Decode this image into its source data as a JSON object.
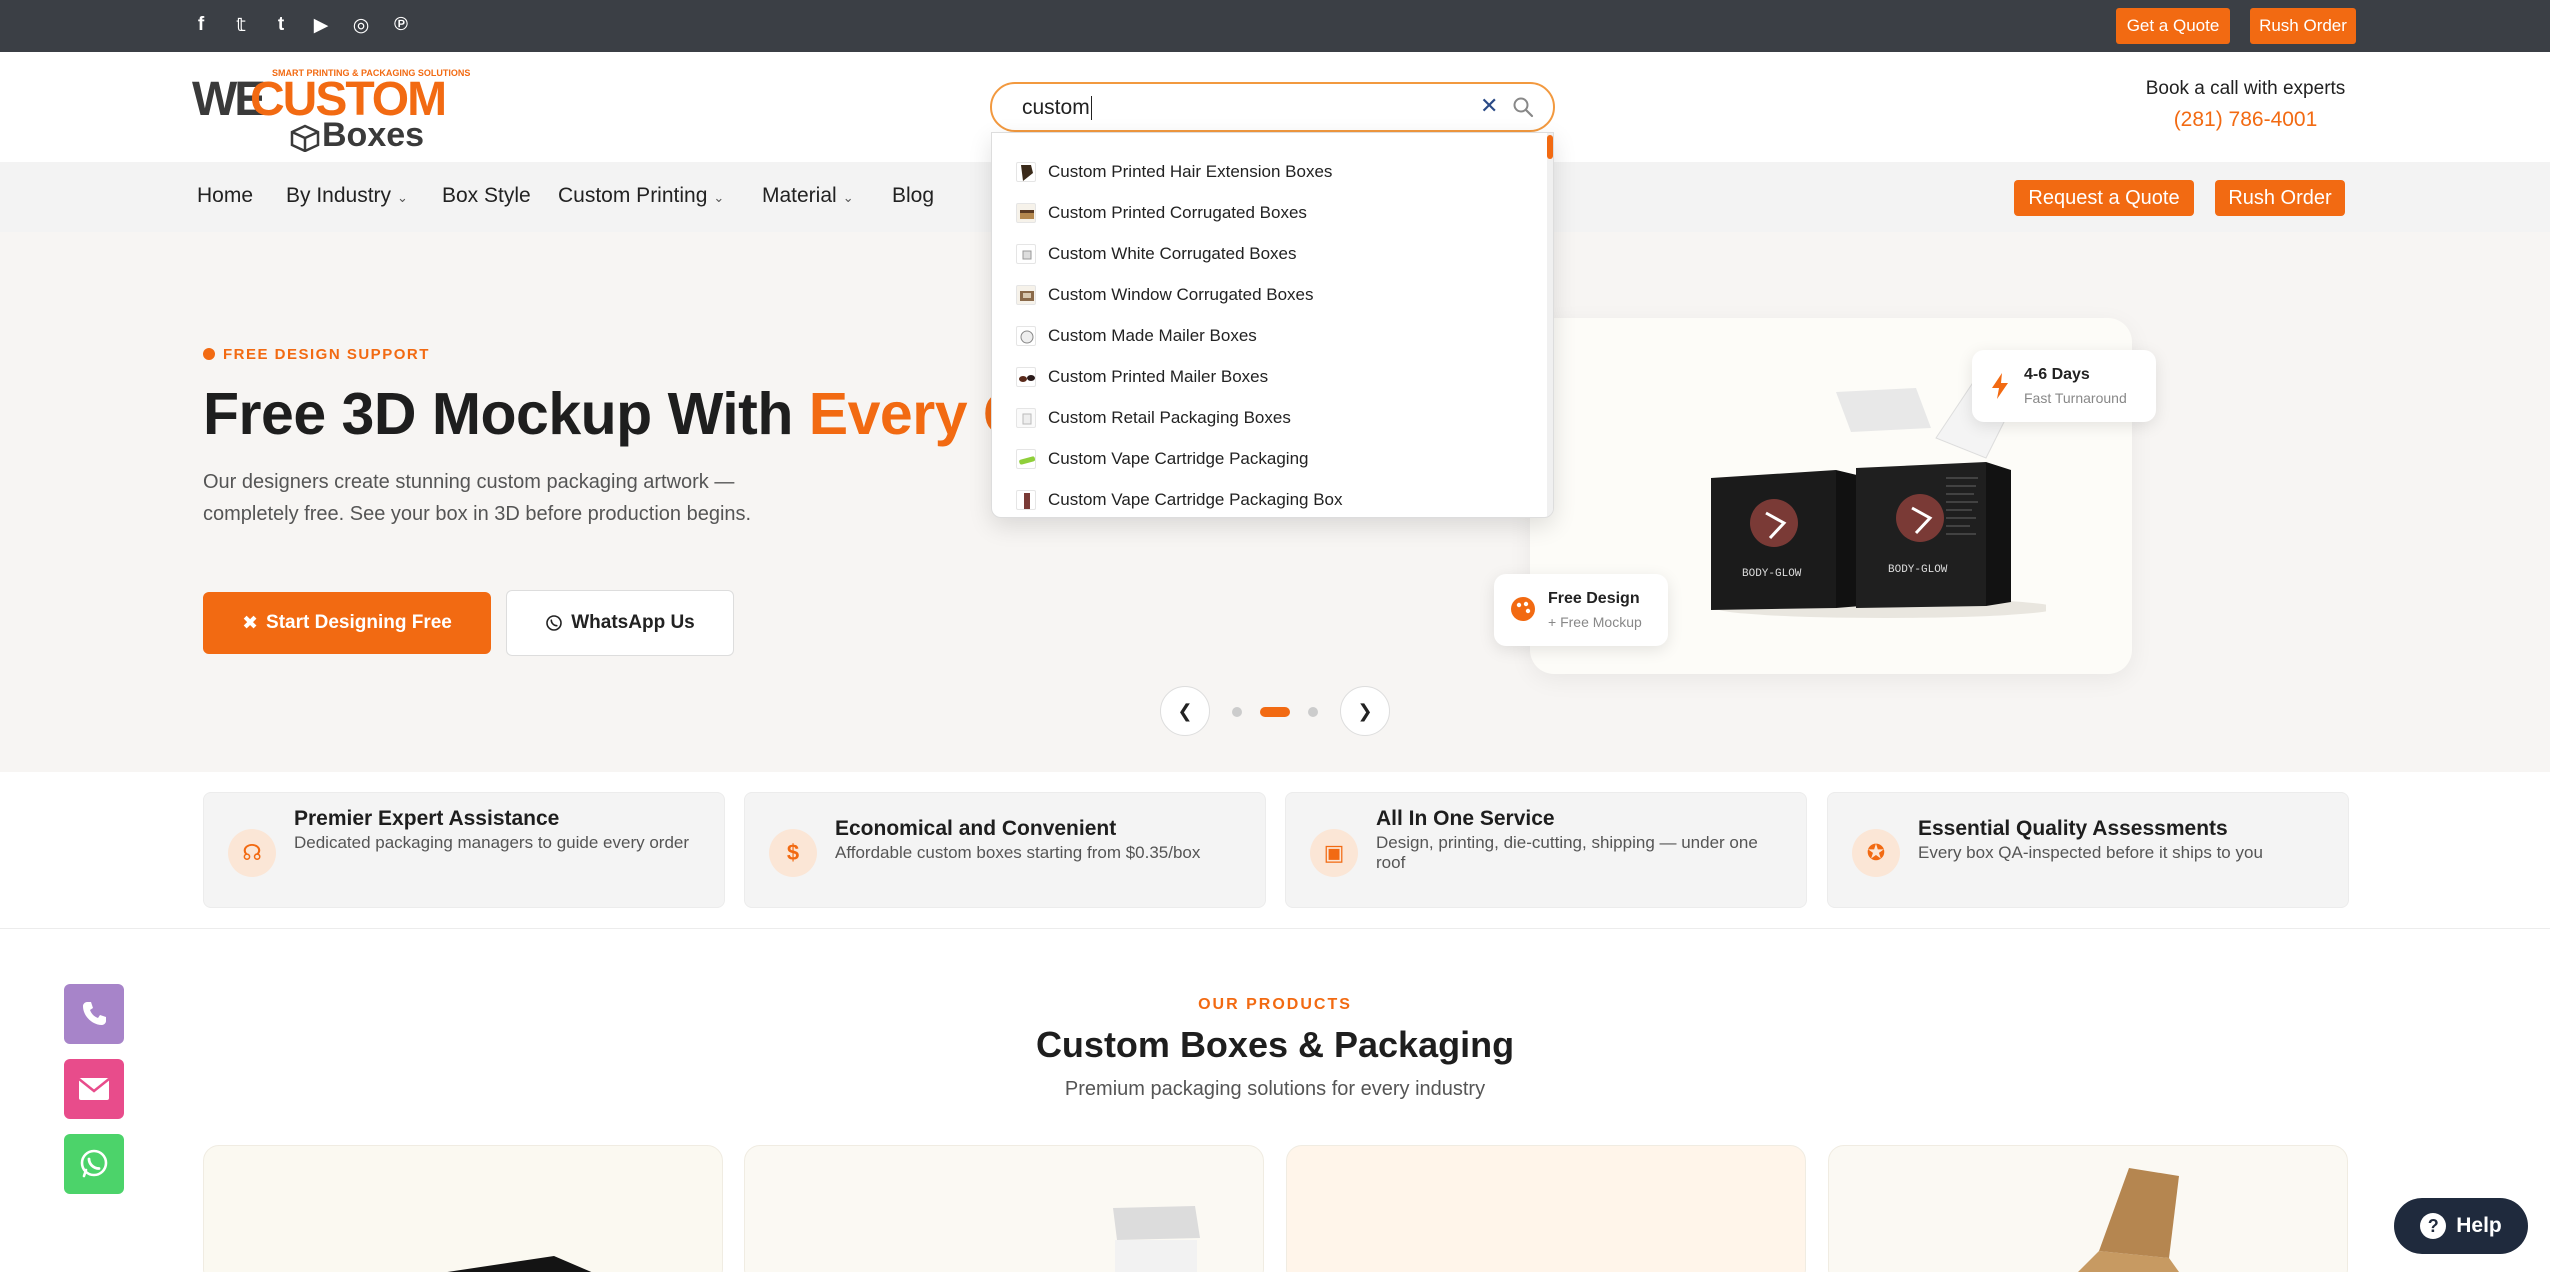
{
  "topbar": {
    "social_icons": [
      "facebook-icon",
      "twitter-icon",
      "tumblr-icon",
      "youtube-icon",
      "instagram-icon",
      "pinterest-icon"
    ],
    "social_glyphs": [
      "f",
      "𝕥",
      "t",
      "▶",
      "◎",
      "℗"
    ],
    "get_quote": "Get a Quote",
    "rush_order": "Rush Order"
  },
  "logo": {
    "we": "WE",
    "custom": "CUSTOM",
    "boxes": "Boxes",
    "tagline": "SMART PRINTING & PACKAGING SOLUTIONS"
  },
  "search": {
    "value": "custom",
    "clear_glyph": "✕",
    "suggestions": [
      "Custom Printed Hair Extension Boxes",
      "Custom Printed Corrugated Boxes",
      "Custom White Corrugated Boxes",
      "Custom Window Corrugated Boxes",
      "Custom Made Mailer Boxes",
      "Custom Printed Mailer Boxes",
      "Custom Retail Packaging Boxes",
      "Custom Vape Cartridge Packaging",
      "Custom Vape Cartridge Packaging Box"
    ]
  },
  "contact": {
    "label": "Book a call with experts",
    "phone": "(281) 786-4001"
  },
  "nav": {
    "items": [
      "Home",
      "By Industry",
      "Box Style",
      "Custom Printing",
      "Material",
      "Blog"
    ],
    "request_quote": "Request a Quote",
    "rush_order": "Rush Order"
  },
  "hero": {
    "eyebrow": "FREE DESIGN SUPPORT",
    "title_main": "Free 3D Mockup With ",
    "title_highlight": "Every C",
    "description": "Our designers create stunning custom packaging artwork — completely free. See your box in 3D before production begins.",
    "start_button": "Start Designing Free",
    "whatsapp_button": "WhatsApp Us",
    "badge_turnaround_title": "4-6 Days",
    "badge_turnaround_sub": "Fast Turnaround",
    "badge_design_title": "Free Design",
    "badge_design_sub": "+ Free Mockup",
    "box_brand": "BODY-GLOW",
    "carousel_active_index": 1,
    "carousel_count": 3
  },
  "features": [
    {
      "title": "Premier Expert Assistance",
      "desc": "Dedicated packaging managers to guide every order",
      "icon": "headset-icon"
    },
    {
      "title": "Economical and Convenient",
      "desc": "Affordable custom boxes starting from $0.35/box",
      "icon": "dollar-icon"
    },
    {
      "title": "All In One Service",
      "desc": "Design, printing, die-cutting, shipping — under one roof",
      "icon": "box-icon"
    },
    {
      "title": "Essential Quality Assessments",
      "desc": "Every box QA-inspected before it ships to you",
      "icon": "award-icon"
    }
  ],
  "products": {
    "eyebrow": "OUR PRODUCTS",
    "title": "Custom Boxes & Packaging",
    "subtitle": "Premium packaging solutions for every industry"
  },
  "help": {
    "label": "Help"
  },
  "colors": {
    "accent": "#f26a12",
    "topbar": "#3b3f45",
    "phone_button": "#a784c9",
    "email_button": "#e84c8b",
    "whatsapp_button": "#4cd36a",
    "help_button": "#1f2a3d"
  }
}
